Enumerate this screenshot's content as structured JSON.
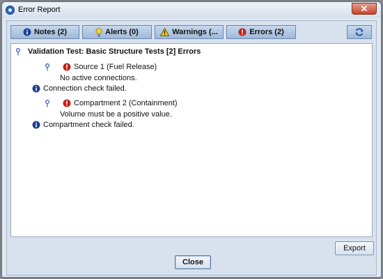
{
  "window": {
    "title": "Error Report",
    "close_glyph": "✕"
  },
  "tabs": [
    {
      "label": "Notes (2)",
      "icon": "info-icon"
    },
    {
      "label": "Alerts (0)",
      "icon": "lightbulb-icon"
    },
    {
      "label": "Warnings (...",
      "icon": "warning-icon"
    },
    {
      "label": "Errors (2)",
      "icon": "error-icon"
    }
  ],
  "refresh_icon": "refresh-icon",
  "report": {
    "header": "Validation Test: Basic Structure Tests [2] Errors",
    "items": [
      {
        "title": "Source 1 (Fuel Release)",
        "detail": "No active connections.",
        "note": "Connection check failed."
      },
      {
        "title": "Compartment 2 (Containment)",
        "detail": "Volume must be a positive value.",
        "note": "Compartment check failed."
      }
    ]
  },
  "buttons": {
    "export": "Export",
    "close": "Close"
  },
  "colors": {
    "info": "#1f3f8f",
    "error": "#c0221c",
    "warning": "#f2c318",
    "tab_bg": "#b3c9e3",
    "pin": "#3b62b0"
  }
}
